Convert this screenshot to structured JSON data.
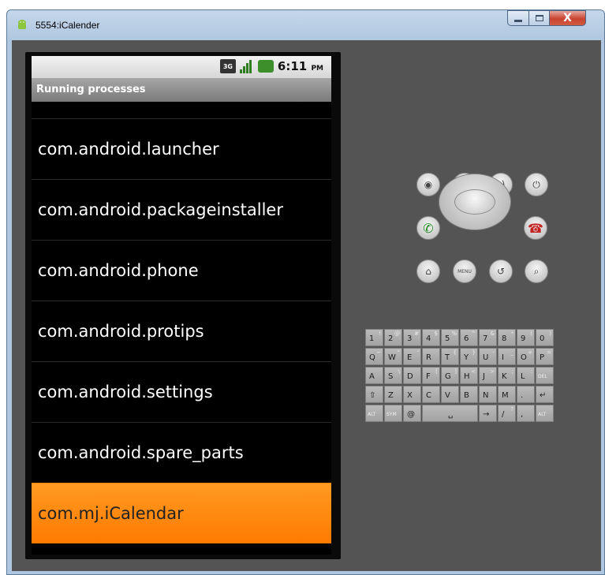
{
  "window": {
    "title": "5554:iCalender",
    "buttons": {
      "minimize": "–",
      "maximize": "□",
      "close": "X"
    }
  },
  "statusbar": {
    "network": "3G",
    "time": "6:11",
    "ampm": "PM"
  },
  "app": {
    "title": "Running processes"
  },
  "processes": [
    "com.android.launcher",
    "com.android.packageinstaller",
    "com.android.phone",
    "com.android.protips",
    "com.android.settings",
    "com.android.spare_parts",
    "com.mj.iCalendar"
  ],
  "selected_process": "com.mj.iCalendar",
  "hardware_buttons": {
    "row1": [
      "camera-icon",
      "volume-down-icon",
      "volume-up-icon",
      "power-icon"
    ],
    "row2": [
      "call-icon",
      "dpad",
      "end-call-icon"
    ],
    "row3": [
      "home-icon",
      "MENU",
      "back-icon",
      "search-icon"
    ]
  },
  "keyboard": {
    "row1": [
      [
        "1",
        "!"
      ],
      [
        "2",
        "@"
      ],
      [
        "3",
        "#"
      ],
      [
        "4",
        "$"
      ],
      [
        "5",
        "%"
      ],
      [
        "6",
        "^"
      ],
      [
        "7",
        "&"
      ],
      [
        "8",
        "*"
      ],
      [
        "9",
        "("
      ],
      [
        "0",
        ")"
      ]
    ],
    "row2": [
      [
        "Q",
        "~"
      ],
      [
        "W",
        "\""
      ],
      [
        "E",
        "'"
      ],
      [
        "R",
        ""
      ],
      [
        "T",
        "{"
      ],
      [
        "Y",
        "}"
      ],
      [
        "U",
        "-"
      ],
      [
        "I",
        "_"
      ],
      [
        "O",
        "+"
      ],
      [
        "P",
        "="
      ]
    ],
    "row3": [
      [
        "A",
        ""
      ],
      [
        "S",
        "\\"
      ],
      [
        "D",
        ""
      ],
      [
        "F",
        "["
      ],
      [
        "G",
        "]"
      ],
      [
        "H",
        "<"
      ],
      [
        "J",
        ">"
      ],
      [
        "K",
        ";"
      ],
      [
        "L",
        ":"
      ],
      [
        "DEL",
        ""
      ]
    ],
    "row4": [
      [
        "⇧",
        ""
      ],
      [
        "Z",
        ""
      ],
      [
        "X",
        ""
      ],
      [
        "C",
        ""
      ],
      [
        "V",
        ""
      ],
      [
        "B",
        ""
      ],
      [
        "N",
        ""
      ],
      [
        "M",
        ""
      ],
      [
        ".",
        ""
      ],
      [
        "↵",
        ""
      ]
    ],
    "row5": [
      [
        "ALT",
        ""
      ],
      [
        "SYM",
        ""
      ],
      [
        "@",
        ""
      ],
      [
        "␣",
        ""
      ],
      [
        "→",
        ""
      ],
      [
        "/",
        "?"
      ],
      [
        ",",
        ""
      ],
      [
        "ALT",
        ""
      ]
    ]
  },
  "colors": {
    "selected_bg": "#ff8a00",
    "list_bg": "#000000",
    "emulator_bg": "#545454"
  }
}
